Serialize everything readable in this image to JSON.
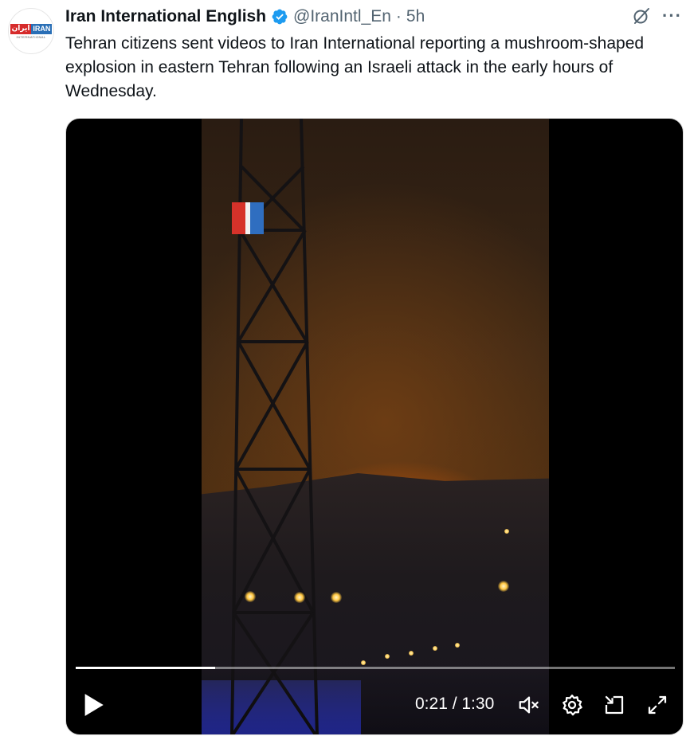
{
  "tweet": {
    "author_name": "Iran International English",
    "handle": "@IranIntl_En",
    "separator": "·",
    "time_ago": "5h",
    "text": "Tehran citizens sent videos to Iran International reporting a mushroom-shaped explosion in eastern Tehran following an Israeli attack in the early hours of Wednesday."
  },
  "avatar": {
    "logo_fa": "ایران",
    "logo_en": "IRAN",
    "logo_sub": "INTERNATIONAL"
  },
  "icons": {
    "verified": "verified-badge-icon",
    "grok": "grok-icon",
    "more": "more-icon",
    "play": "play-icon",
    "mute": "mute-icon",
    "settings": "settings-icon",
    "dock": "dock-icon",
    "fullscreen": "fullscreen-icon"
  },
  "more_label": "···",
  "video": {
    "current_time": "0:21",
    "duration": "1:30",
    "time_display": "0:21 / 1:30",
    "progress": 0.233
  },
  "colors": {
    "verified_blue": "#1d9bf0",
    "secondary_text": "#536471",
    "primary_text": "#0f1419",
    "brand_red": "#d6322a",
    "brand_blue": "#2f6ec0"
  }
}
